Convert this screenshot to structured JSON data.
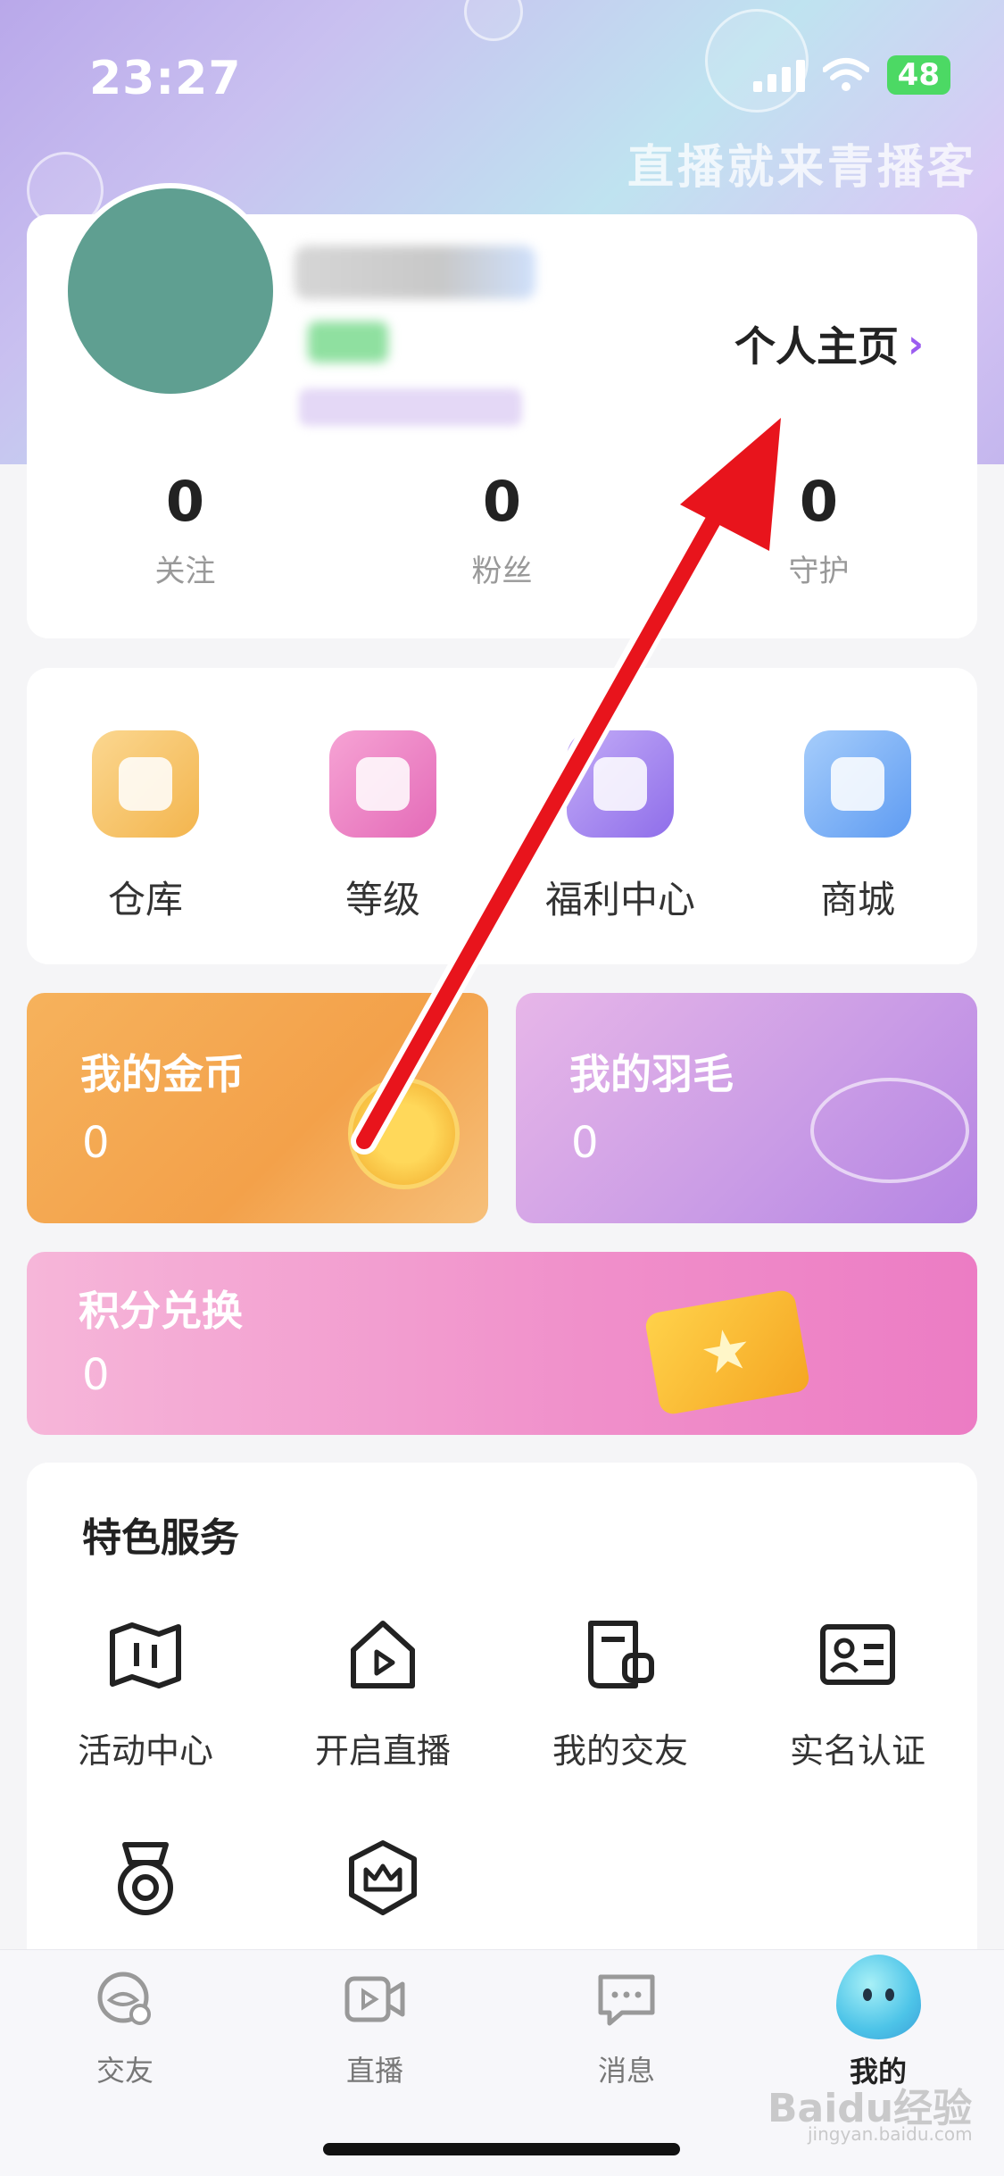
{
  "status": {
    "time": "23:27",
    "battery": "48"
  },
  "slogan": "直播就来青播客",
  "profile": {
    "homepage_link": "个人主页",
    "chevron": "›",
    "stats": [
      {
        "value": "0",
        "label": "关注"
      },
      {
        "value": "0",
        "label": "粉丝"
      },
      {
        "value": "0",
        "label": "守护"
      }
    ],
    "avatar_color": "#5f9f91"
  },
  "quick": [
    {
      "label": "仓库",
      "icon": "warehouse-icon",
      "color": "#f6c36d"
    },
    {
      "label": "等级",
      "icon": "level-icon",
      "color": "#f088c6"
    },
    {
      "label": "福利中心",
      "icon": "welfare-icon",
      "color": "#a98cf2"
    },
    {
      "label": "商城",
      "icon": "mall-icon",
      "color": "#7eb4f7"
    }
  ],
  "banners": {
    "coins": {
      "title": "我的金币",
      "value": "0"
    },
    "feathers": {
      "title": "我的羽毛",
      "value": "0"
    },
    "points": {
      "title": "积分兑换",
      "value": "0"
    }
  },
  "services": {
    "title": "特色服务",
    "items": [
      {
        "label": "活动中心",
        "icon": "map-icon"
      },
      {
        "label": "开启直播",
        "icon": "live-play-icon"
      },
      {
        "label": "我的交友",
        "icon": "friends-note-icon"
      },
      {
        "label": "实名认证",
        "icon": "id-card-icon"
      },
      {
        "label": "",
        "icon": "medal-icon"
      },
      {
        "label": "",
        "icon": "crown-icon"
      }
    ]
  },
  "tabs": [
    {
      "label": "交友",
      "icon": "friends-tab-icon"
    },
    {
      "label": "直播",
      "icon": "live-tab-icon"
    },
    {
      "label": "消息",
      "icon": "message-tab-icon"
    },
    {
      "label": "我的",
      "icon": "mine-mascot-icon",
      "active": true
    }
  ],
  "watermark": {
    "text": "Baidu经验",
    "sub": "jingyan.baidu.com"
  },
  "colors": {
    "arrow": "#e8141c",
    "accent": "#9b5cf0"
  }
}
